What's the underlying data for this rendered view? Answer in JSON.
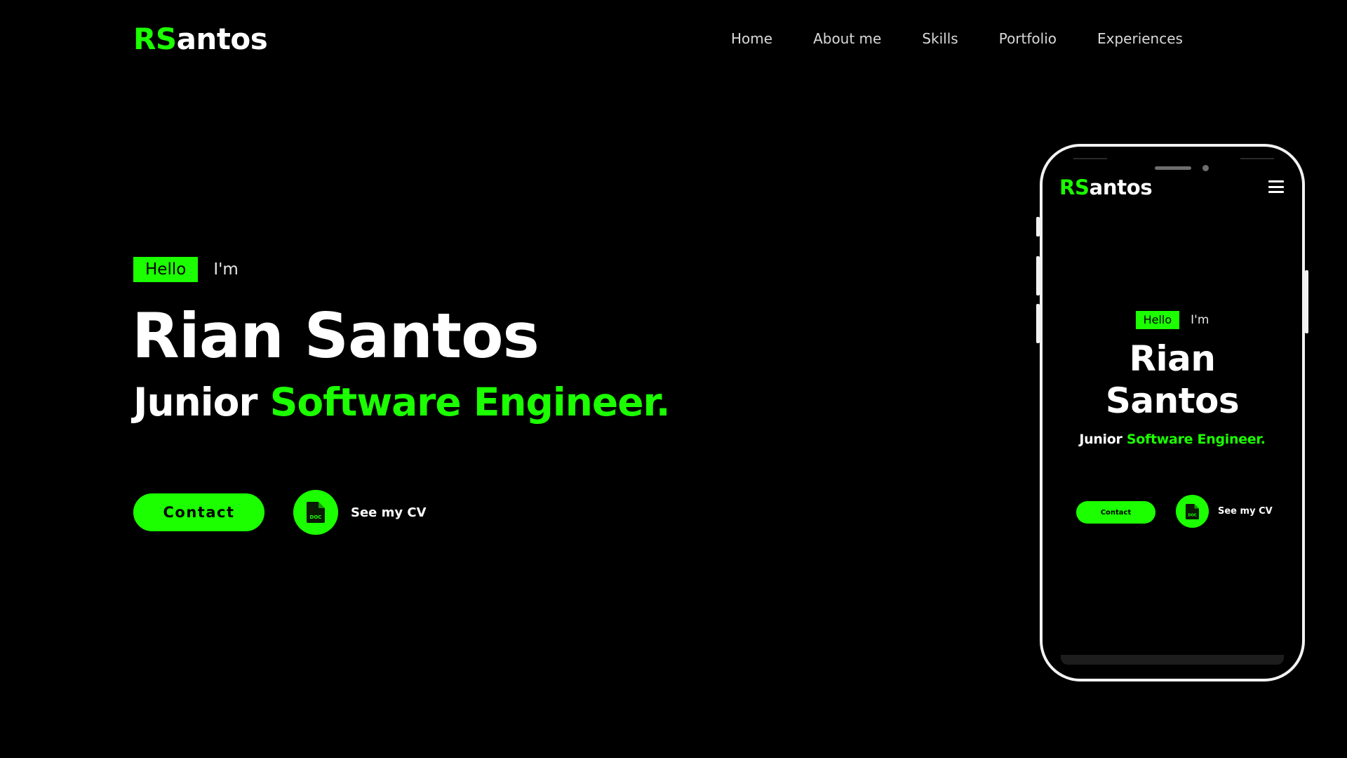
{
  "logo": {
    "prefix": "RS",
    "suffix": "antos"
  },
  "nav": {
    "items": [
      {
        "label": "Home"
      },
      {
        "label": "About me"
      },
      {
        "label": "Skills"
      },
      {
        "label": "Portfolio"
      },
      {
        "label": "Experiences"
      }
    ]
  },
  "hero": {
    "hello": "Hello",
    "im": "I'm",
    "name": "Rian Santos",
    "role_prefix": "Junior",
    "role_accent": "Software Engineer.",
    "contact_label": "Contact",
    "cv_label": "See my CV",
    "cv_icon": "doc-file-icon"
  },
  "mobile": {
    "logo": {
      "prefix": "RS",
      "suffix": "antos"
    },
    "menu_icon": "hamburger-menu-icon",
    "hello": "Hello",
    "im": "I'm",
    "name_first": "Rian",
    "name_last": "Santos",
    "role_prefix": "Junior",
    "role_accent": "Software Engineer.",
    "contact_label": "Contact",
    "cv_label": "See my CV"
  },
  "colors": {
    "background": "#000000",
    "accent": "#1bff00",
    "text": "#ffffff",
    "nav_text": "#d9d9d9"
  }
}
